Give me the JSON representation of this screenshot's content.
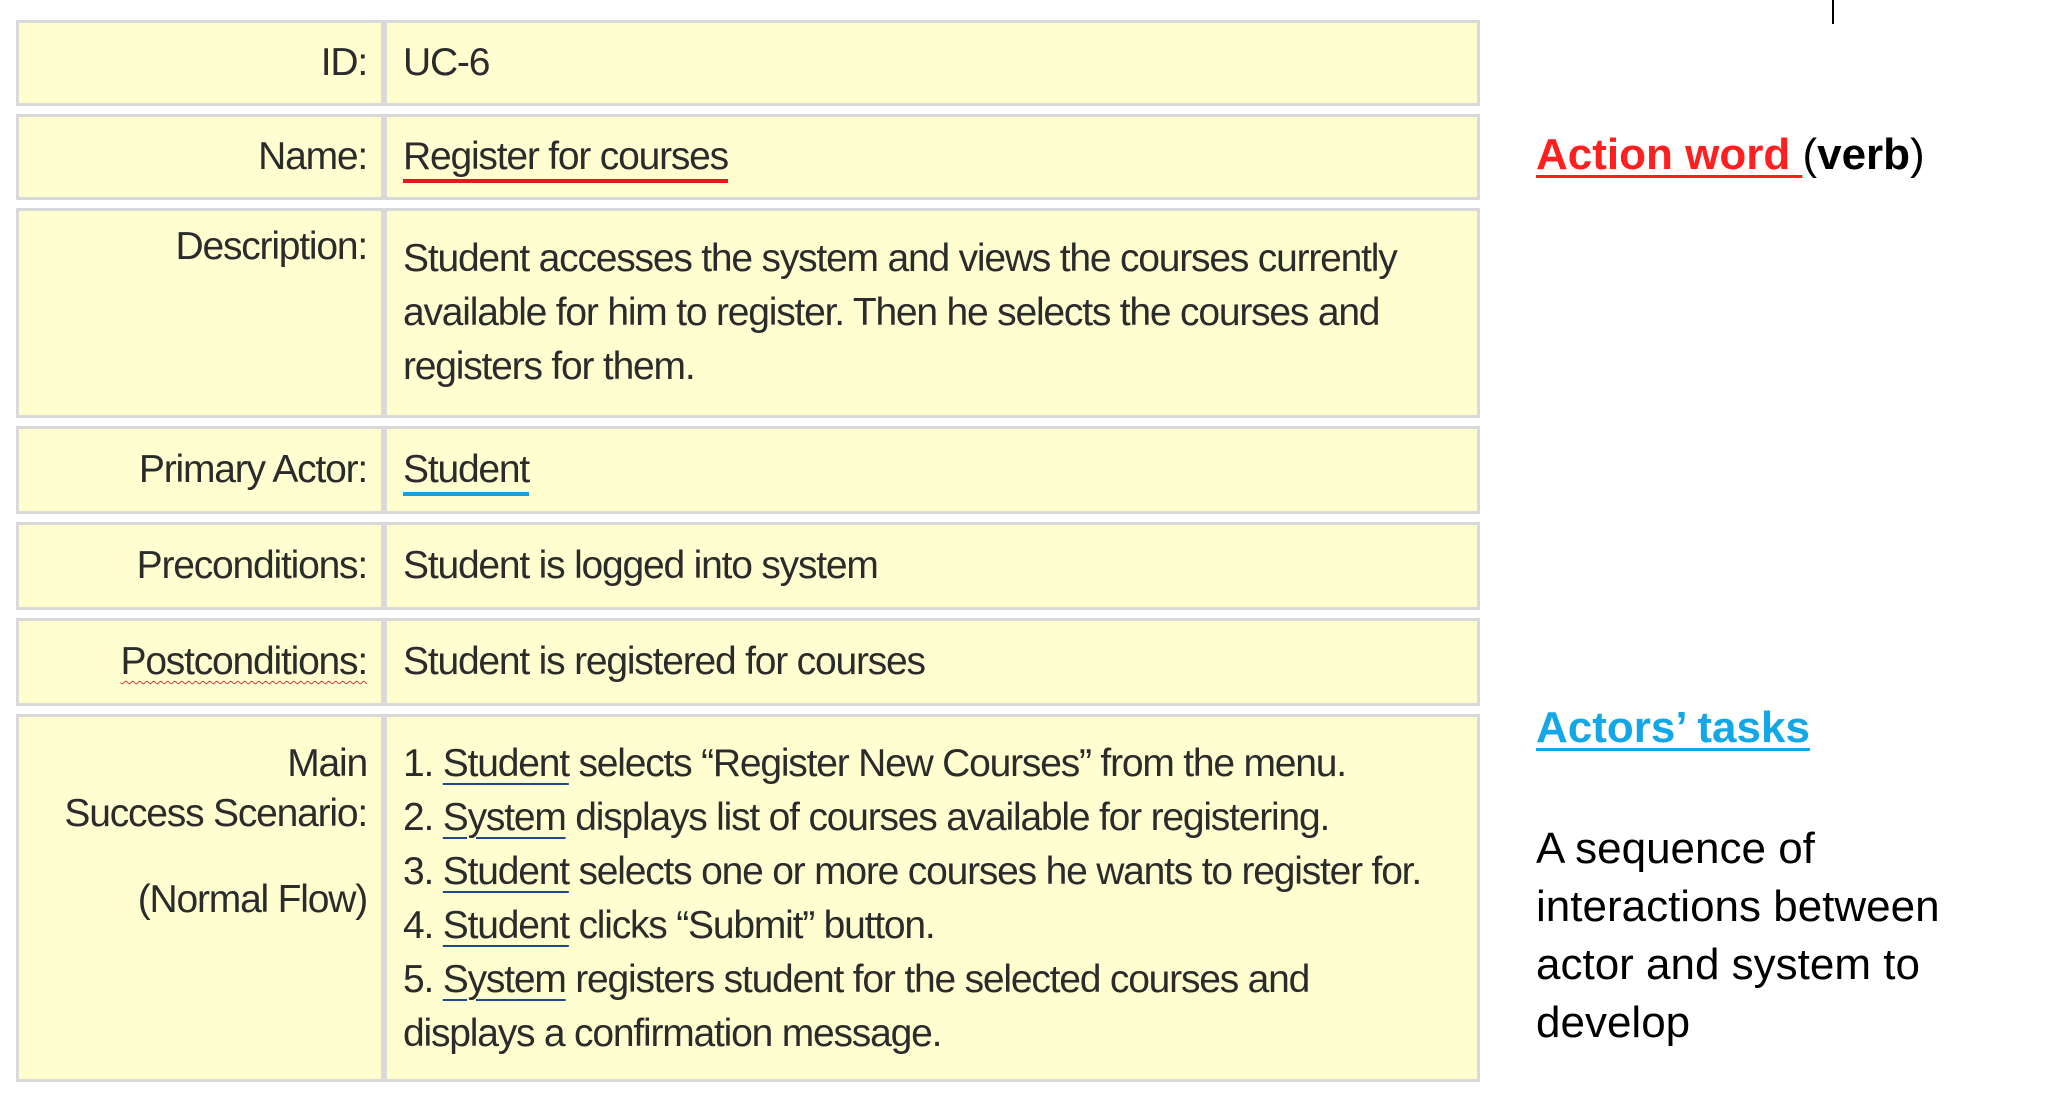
{
  "use_case": {
    "id": {
      "label": "ID:",
      "value": "UC-6"
    },
    "name": {
      "label": "Name:",
      "value": "Register for courses"
    },
    "description": {
      "label": "Description:",
      "lines": [
        "Student accesses the system and views the courses currently",
        "available for him to register. Then he selects the courses and",
        "registers for them."
      ]
    },
    "primary_actor": {
      "label": "Primary Actor:",
      "value": "Student"
    },
    "preconditions": {
      "label": "Preconditions:",
      "value": "Student is logged into system"
    },
    "postconditions": {
      "label": "Postconditions:",
      "value": "Student is registered for courses"
    },
    "main_scenario": {
      "label_line1": "Main",
      "label_line2": "Success Scenario:",
      "label_line3": "(Normal Flow)",
      "steps": [
        {
          "num": "1.",
          "actor": "Student",
          "text": "selects “Register New Courses” from the menu."
        },
        {
          "num": "2.",
          "actor": "System",
          "text": "displays list of courses available for registering."
        },
        {
          "num": "3.",
          "actor": "Student",
          "text": "selects one or more courses he wants to register for."
        },
        {
          "num": "4.",
          "actor": "Student",
          "text": "clicks “Submit” button."
        },
        {
          "num": "5.",
          "actor": "System",
          "text": "registers student for the selected courses and"
        }
      ],
      "step5_cont": "displays a confirmation message."
    }
  },
  "annotations": {
    "action_word": "Action word ",
    "paren_open": "(",
    "verb": "verb",
    "paren_close": ")",
    "actors_tasks": "Actors’ tasks",
    "sequence_text": "A sequence of interactions between actor and system to develop"
  },
  "colors": {
    "cell_bg": "#fefed0",
    "red": "#ff1f1f",
    "blue": "#14a7e6"
  }
}
